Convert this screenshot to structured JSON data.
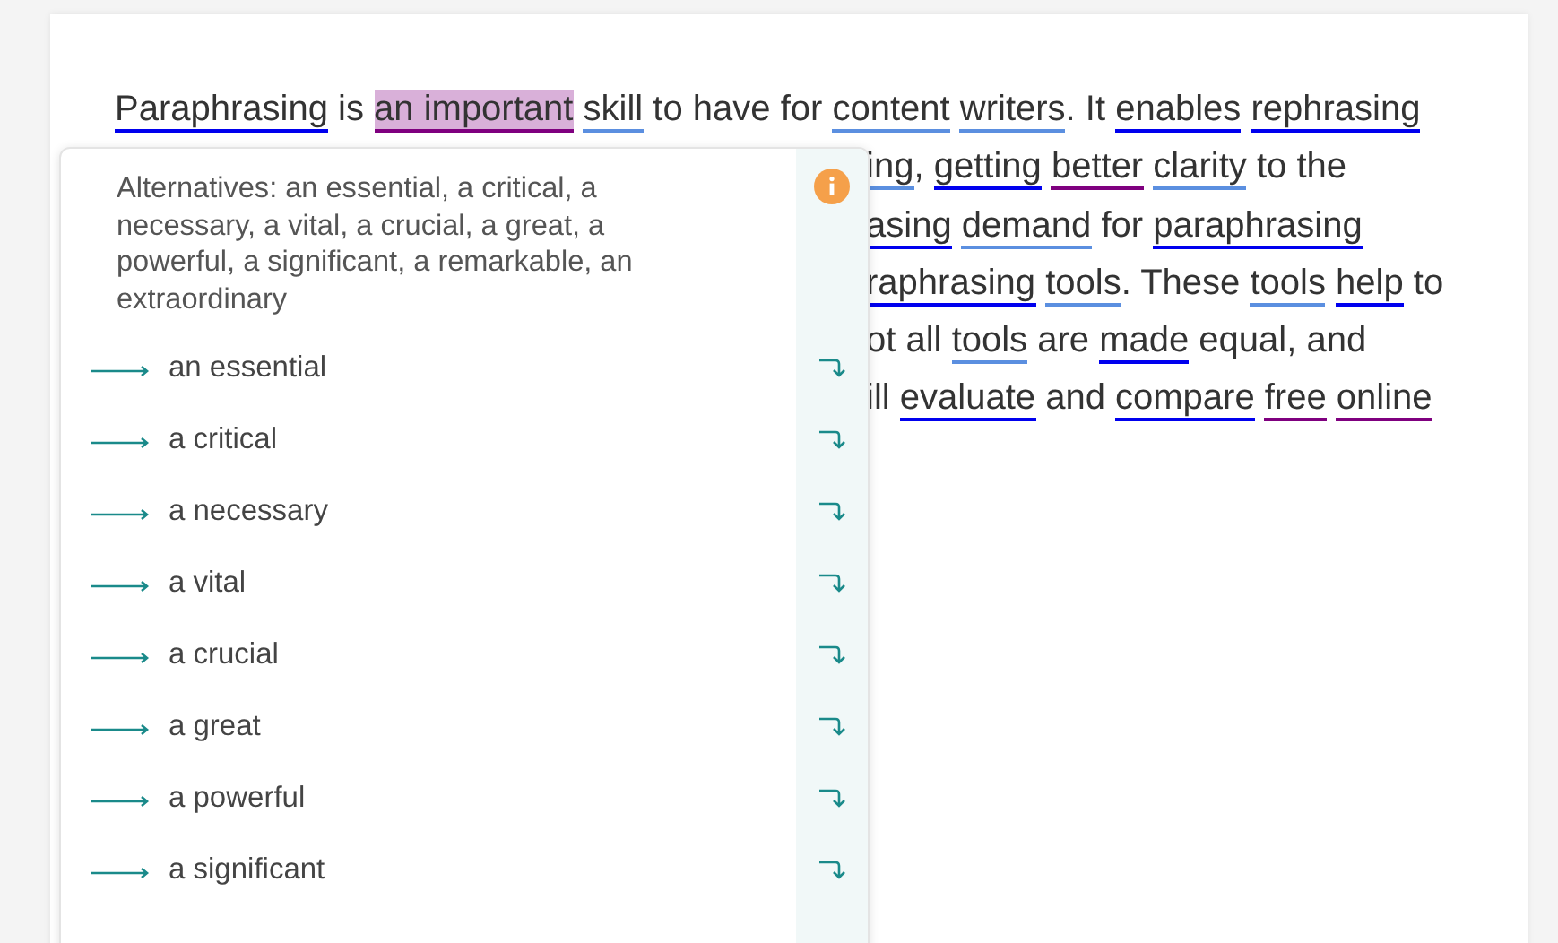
{
  "document": {
    "lines": [
      [
        {
          "text": "Paraphrasing",
          "color": "#0000ee"
        },
        {
          "text": " is "
        },
        {
          "text": "an important",
          "color": "#7f007f",
          "selected": true
        },
        {
          "text": "skill",
          "color": "#5b8fe0"
        },
        {
          "text": " to have for "
        },
        {
          "text": "content",
          "color": "#5b8fe0"
        },
        {
          "text": "writers",
          "color": "#5b8fe0"
        },
        {
          "text": ". It "
        },
        {
          "text": "enables",
          "color": "#0000ee"
        },
        {
          "text": "rephrasing",
          "color": "#0000ee"
        }
      ],
      [
        {
          "text": "ing",
          "color": "#5b8fe0"
        },
        {
          "text": ", "
        },
        {
          "text": "getting",
          "color": "#0000ee"
        },
        {
          "text": "better",
          "color": "#7f007f"
        },
        {
          "text": "clarity",
          "color": "#5b8fe0"
        },
        {
          "text": " to the"
        }
      ],
      [
        {
          "text": "asing",
          "color": "#0000ee"
        },
        {
          "text": "demand",
          "color": "#5b8fe0"
        },
        {
          "text": " for "
        },
        {
          "text": "paraphrasing",
          "color": "#0000ee"
        }
      ],
      [
        {
          "text": "raphrasing",
          "color": "#0000ee"
        },
        {
          "text": "tools",
          "color": "#5b8fe0"
        },
        {
          "text": ". These "
        },
        {
          "text": "tools",
          "color": "#5b8fe0"
        },
        {
          "text": "help",
          "color": "#0000ee"
        },
        {
          "text": " to"
        }
      ],
      [
        {
          "text": "ot all "
        },
        {
          "text": "tools",
          "color": "#5b8fe0"
        },
        {
          "text": " are "
        },
        {
          "text": "made",
          "color": "#0000ee"
        },
        {
          "text": " equal, and"
        }
      ],
      [
        {
          "text": "ill "
        },
        {
          "text": "evaluate",
          "color": "#0000ee"
        },
        {
          "text": " and "
        },
        {
          "text": "compare",
          "color": "#0000ee"
        },
        {
          "text": "free",
          "color": "#7f007f"
        },
        {
          "text": "online",
          "color": "#7f007f"
        }
      ]
    ]
  },
  "popup": {
    "description": "Alternatives: an essential, a critical, a necessary, a vital, a crucial, a great, a powerful, a significant, a remarkable, an extraordinary",
    "alternatives": [
      "an essential",
      "a critical",
      "a necessary",
      "a vital",
      "a crucial",
      "a great",
      "a powerful",
      "a significant"
    ]
  }
}
